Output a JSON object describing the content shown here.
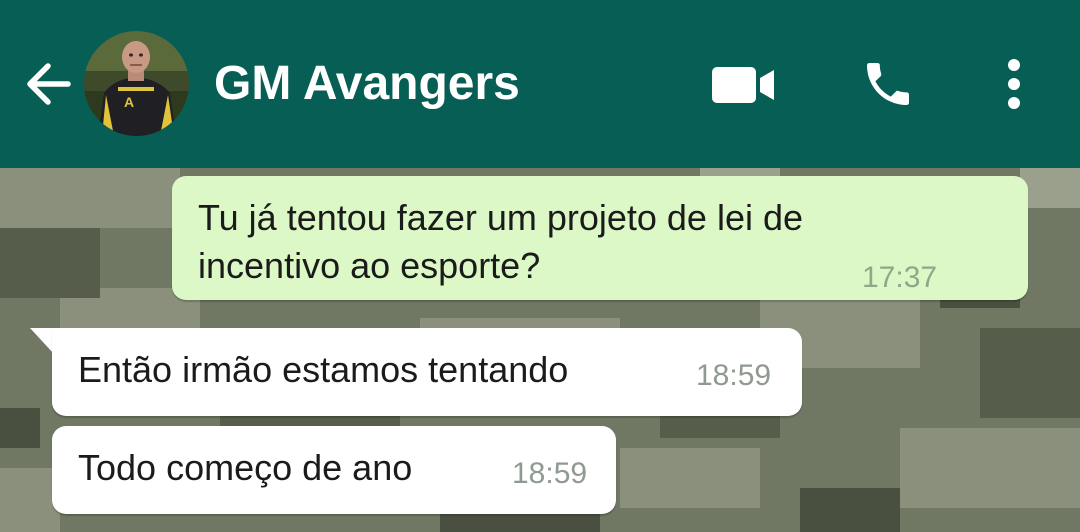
{
  "header": {
    "contact_name": "GM Avangers",
    "back_icon": "arrow-left-icon",
    "video_icon": "video-camera-icon",
    "call_icon": "phone-icon",
    "menu_icon": "more-vertical-icon",
    "bar_color": "#075e54"
  },
  "messages": [
    {
      "direction": "outgoing",
      "lines": [
        "Tu já tentou fazer um projeto de lei de",
        "incentivo ao esporte?"
      ],
      "time": "17:37",
      "status_icon": "double-check-icon",
      "bubble_color": "#dcf8c6"
    },
    {
      "direction": "incoming",
      "text": "Então irmão estamos tentando",
      "time": "18:59",
      "bubble_color": "#ffffff"
    },
    {
      "direction": "incoming",
      "text": "Todo começo de ano",
      "time": "18:59",
      "bubble_color": "#ffffff"
    }
  ]
}
